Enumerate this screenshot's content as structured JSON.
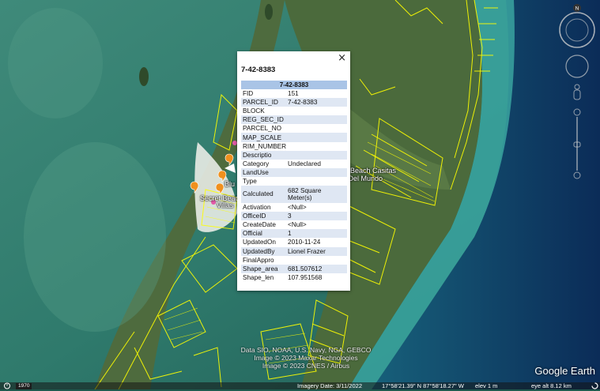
{
  "popup": {
    "title": "7-42-8383",
    "header": "7-42-8383",
    "close_label": "×",
    "rows": [
      {
        "key": "FID",
        "value": "151"
      },
      {
        "key": "PARCEL_ID",
        "value": "7-42-8383"
      },
      {
        "key": "BLOCK",
        "value": ""
      },
      {
        "key": "REG_SEC_ID",
        "value": ""
      },
      {
        "key": "PARCEL_NO",
        "value": ""
      },
      {
        "key": "MAP_SCALE",
        "value": ""
      },
      {
        "key": "RIM_NUMBER",
        "value": ""
      },
      {
        "key": "Descriptio",
        "value": ""
      },
      {
        "key": "Category",
        "value": "Undeclared"
      },
      {
        "key": "LandUse",
        "value": ""
      },
      {
        "key": "Type",
        "value": ""
      },
      {
        "key": "Calculated",
        "value": "682 Square Meter(s)"
      },
      {
        "key": "Activation",
        "value": "<Null>"
      },
      {
        "key": "OfficeID",
        "value": "3"
      },
      {
        "key": "CreateDate",
        "value": "<Null>"
      },
      {
        "key": "Official",
        "value": "1"
      },
      {
        "key": "UpdatedOn",
        "value": "2010-11-24"
      },
      {
        "key": "UpdatedBy",
        "value": "Lionel Frazer"
      },
      {
        "key": "FinalAppro",
        "value": ""
      },
      {
        "key": "Shape_area",
        "value": "681.507612"
      },
      {
        "key": "Shape_len",
        "value": "107.951568"
      }
    ]
  },
  "map_labels": {
    "casitas": "et Beach Casitas",
    "mundo": "n Del Mundo",
    "blu": "Blu",
    "secret_beach": "Secret Beac",
    "villas": "Villas"
  },
  "credits": {
    "line1": "Data SIO, NOAA, U.S. Navy, NGA, GEBCO",
    "line2": "Image © 2023 Maxar Technologies",
    "line3": "Image © 2023 CNES / Airbus"
  },
  "logo": "Google Earth",
  "status": {
    "year": "1970",
    "imagery_date": "Imagery Date: 3/11/2022",
    "coordinates": "17°58'21.39\" N   87°58'18.27\" W",
    "elev": "elev     1 m",
    "eye_alt": "eye alt   8.12 km"
  },
  "nav": {
    "north": "N"
  },
  "colors": {
    "parcel": "#ffff00",
    "header": "#a9c4e6",
    "alt_row": "#dfe7f3"
  }
}
